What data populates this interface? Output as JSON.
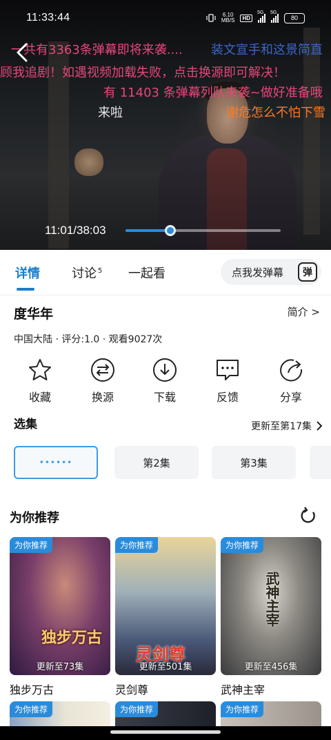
{
  "status_bar": {
    "time": "11:33:44",
    "net_speed": "6.10",
    "net_unit": "MB/S",
    "hd": "HD",
    "sig1": "5G",
    "sig2": "5G",
    "battery": "80"
  },
  "player": {
    "current_time": "11:01",
    "total_time": "38:03",
    "time_text": "11:01/38:03",
    "progress_fraction": 0.29,
    "danmaku": [
      {
        "text": "一共有3363条弹幕即将来袭....",
        "color": "pink"
      },
      {
        "text": "装文宣手和这景简直",
        "color": "blue"
      },
      {
        "text": "顾我追剧！如遇视频加载失败，点击换源即可解决！",
        "color": "pink"
      },
      {
        "text": "有 11403 条弹幕列队来袭~做好准备哦",
        "color": "pink"
      },
      {
        "text": "来啦",
        "color": "white"
      },
      {
        "text": "谢危怎么不怕下雪",
        "color": "orange"
      }
    ]
  },
  "tabs": [
    {
      "label": "详情",
      "badge": ""
    },
    {
      "label": "讨论",
      "badge": "5"
    },
    {
      "label": "一起看",
      "badge": ""
    }
  ],
  "danmaku_input": {
    "placeholder": "点我发弹幕",
    "icon_text": "弹"
  },
  "show": {
    "title": "度华年",
    "intro_link": "简介 >",
    "meta": "中国大陆 · 评分:1.0 · 观看9027次"
  },
  "actions": [
    {
      "label": "收藏",
      "icon": "star-icon"
    },
    {
      "label": "换源",
      "icon": "swap-icon"
    },
    {
      "label": "下载",
      "icon": "download-icon"
    },
    {
      "label": "反馈",
      "icon": "feedback-icon"
    },
    {
      "label": "分享",
      "icon": "share-icon"
    }
  ],
  "episodes": {
    "section_title": "选集",
    "update_text": "更新至第17集",
    "items": [
      "••••••",
      "第2集",
      "第3集",
      ""
    ]
  },
  "recommend": {
    "title": "为你推荐",
    "badge": "为你推荐",
    "cards": [
      {
        "name": "独步万古",
        "update": "更新至73集",
        "poster_text": "独步万古"
      },
      {
        "name": "灵剑尊",
        "update": "更新至501集",
        "poster_text": "灵剑尊"
      },
      {
        "name": "武神主宰",
        "update": "更新至456集",
        "poster_text": "武神主宰"
      }
    ],
    "row2_badges": [
      "为你推荐",
      "为你推荐",
      "为你推荐"
    ]
  },
  "colors": {
    "accent": "#1a7ecf",
    "progress": "#2a8bdb",
    "danmaku_pink": "#e8467a",
    "danmaku_orange": "#ff7a22"
  }
}
